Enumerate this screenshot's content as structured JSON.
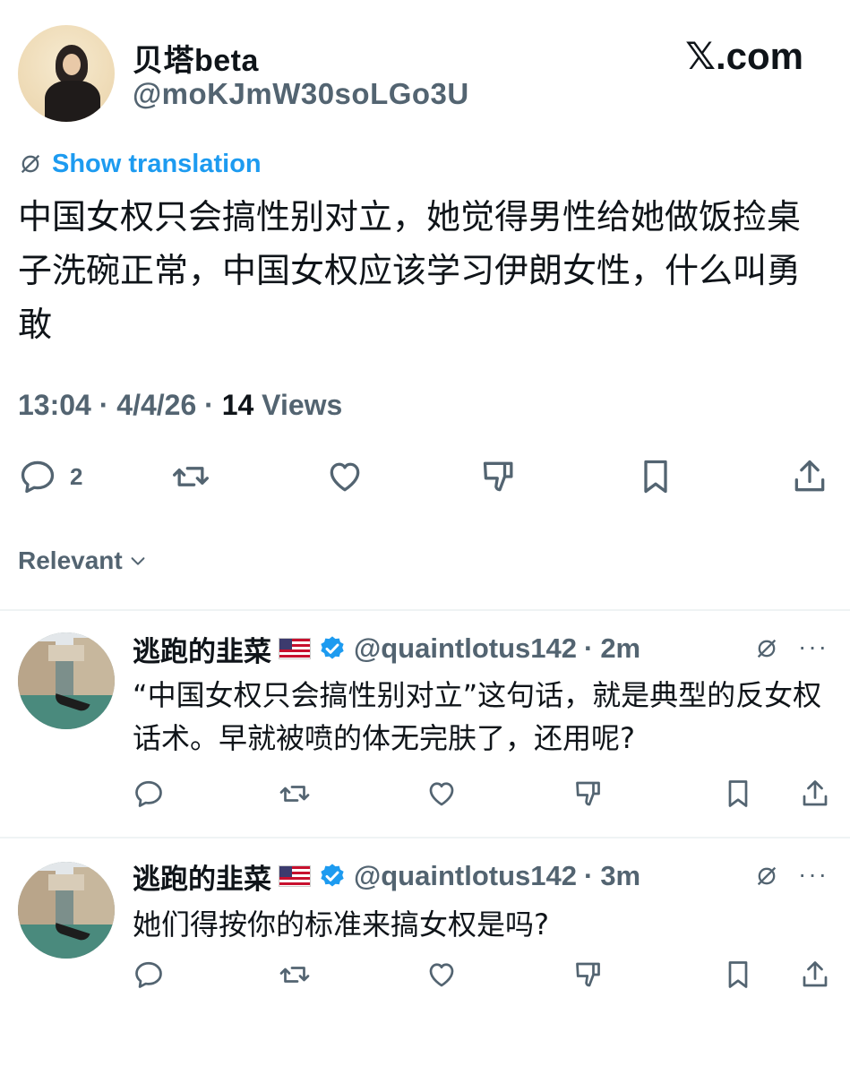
{
  "header": {
    "display_name": "贝塔beta",
    "handle": "@moKJmW30soLGo3U",
    "brand": "𝕏.com"
  },
  "translation": {
    "label": "Show translation"
  },
  "tweet": {
    "text": "中国女权只会搞性别对立，她觉得男性给她做饭捡桌子洗碗正常，中国女权应该学习伊朗女性，什么叫勇敢",
    "time": "13:04",
    "date": "4/4/26",
    "views_count": "14",
    "views_label": "Views",
    "reply_count": "2"
  },
  "sort": {
    "label": "Relevant"
  },
  "replies": [
    {
      "name": "逃跑的韭菜",
      "handle": "@quaintlotus142",
      "age": "2m",
      "text": "“中国女权只会搞性别对立”这句话，就是典型的反女权话术。早就被喷的体无完肤了，还用呢?"
    },
    {
      "name": "逃跑的韭菜",
      "handle": "@quaintlotus142",
      "age": "3m",
      "text": "她们得按你的标准来搞女权是吗?"
    }
  ],
  "colors": {
    "accent": "#1d9bf0",
    "muted": "#536471",
    "text": "#0f1419",
    "verified": "#1d9bf0"
  },
  "icons": [
    "reply-icon",
    "retweet-icon",
    "like-icon",
    "dislike-icon",
    "bookmark-icon",
    "share-icon",
    "translate-icon",
    "verified-icon",
    "more-icon",
    "chevron-down-icon"
  ]
}
